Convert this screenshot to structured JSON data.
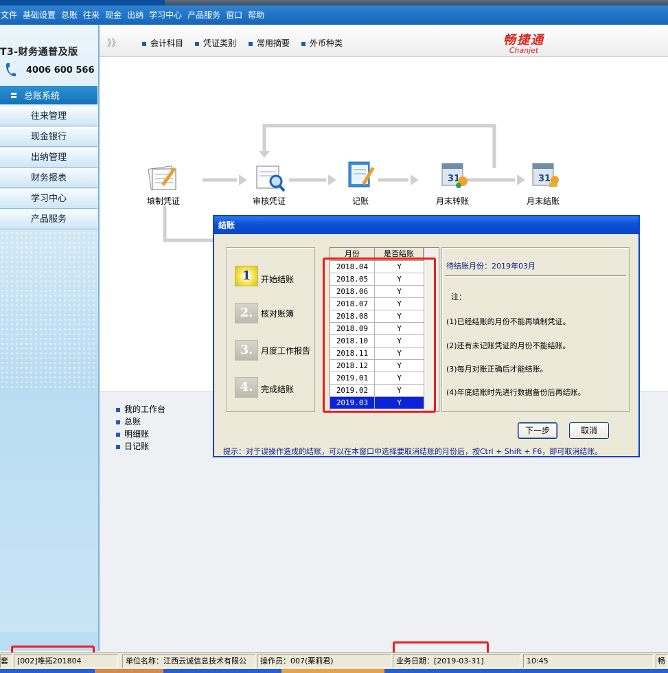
{
  "menu": [
    "文件",
    "基础设置",
    "总账",
    "往来",
    "现金",
    "出纳",
    "学习中心",
    "产品服务",
    "窗口",
    "帮助"
  ],
  "sidebar": {
    "brand": "T3-财务通普及版",
    "phone": "4006 600 566",
    "active": "总账系统",
    "items": [
      "往来管理",
      "现金银行",
      "出纳管理",
      "财务报表",
      "学习中心",
      "产品服务"
    ]
  },
  "toolbar": {
    "links": [
      "会计科目",
      "凭证类别",
      "常用摘要",
      "外币种类"
    ],
    "logo_cn": "畅捷通",
    "logo_en": "Chanjet"
  },
  "workflow": [
    "填制凭证",
    "审核凭证",
    "记账",
    "月末转账",
    "月末结账"
  ],
  "lower_links": [
    "我的工作台",
    "总账",
    "明细账",
    "日记账"
  ],
  "dialog": {
    "title": "结账",
    "steps": [
      {
        "num": "1",
        "label": "开始结账",
        "active": true
      },
      {
        "num": "2.",
        "label": "核对账簿",
        "active": false
      },
      {
        "num": "3.",
        "label": "月度工作报告",
        "active": false
      },
      {
        "num": "4.",
        "label": "完成结账",
        "active": false
      }
    ],
    "table": {
      "headers": [
        "月份",
        "是否结账"
      ],
      "rows": [
        {
          "month": "2018.04",
          "closed": "Y"
        },
        {
          "month": "2018.05",
          "closed": "Y"
        },
        {
          "month": "2018.06",
          "closed": "Y"
        },
        {
          "month": "2018.07",
          "closed": "Y"
        },
        {
          "month": "2018.08",
          "closed": "Y"
        },
        {
          "month": "2018.09",
          "closed": "Y"
        },
        {
          "month": "2018.10",
          "closed": "Y"
        },
        {
          "month": "2018.11",
          "closed": "Y"
        },
        {
          "month": "2018.12",
          "closed": "Y"
        },
        {
          "month": "2019.01",
          "closed": "Y"
        },
        {
          "month": "2019.02",
          "closed": "Y"
        },
        {
          "month": "2019.03",
          "closed": "Y"
        }
      ],
      "selected": "2019.03"
    },
    "info": {
      "pending": "待结账月份：2019年03月",
      "note_label": "注：",
      "notes": [
        "(1)已经结账的月份不能再填制凭证。",
        "(2)还有未记账凭证的月份不能结账。",
        "(3)每月对账正确后才能结账。",
        "(4)年底结账时先进行数据备份后再结账。"
      ]
    },
    "buttons": {
      "next": "下一步",
      "cancel": "取消"
    },
    "hint": "提示：对于误操作造成的结账，可以在本窗口中选择要取消结账的月份后，按Ctrl + Shift + F6，即可取消结账。"
  },
  "statusbar": {
    "account_label": "套",
    "account": "[002]唯拓201804",
    "company": "单位名称：江西云诚信息技术有限公",
    "operator": "操作员：007(栗莉君)",
    "biz_date": "业务日期：[2019-03-31]",
    "time": "10:45",
    "end": "畅"
  },
  "colors": {
    "menubar": "#1566b8",
    "dialog_title": "#0c4fd6",
    "highlight": "#ef1b1b",
    "selected_row": "#0b24d8"
  }
}
